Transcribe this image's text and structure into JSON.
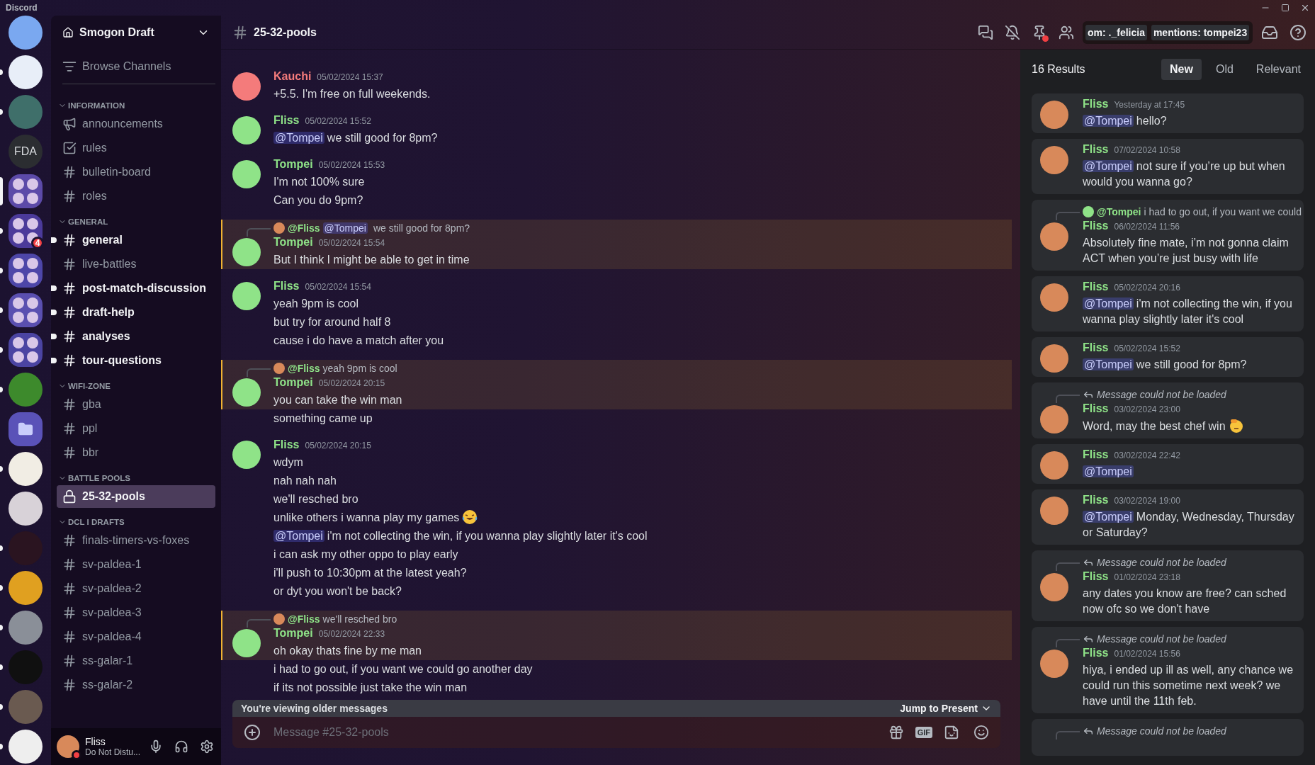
{
  "app": {
    "title": "Discord"
  },
  "servers": [
    {
      "kind": "avatar",
      "color": "#7aa8f0",
      "unread": false,
      "selected": false
    },
    {
      "kind": "avatar",
      "color": "#e8eef8",
      "unread": true,
      "selected": false
    },
    {
      "kind": "avatar",
      "color": "#3f6f6a",
      "unread": true,
      "selected": false
    },
    {
      "kind": "text",
      "label": "FDA",
      "unread": false,
      "selected": false
    },
    {
      "kind": "folder",
      "color": "#5c4aa8",
      "unread": false,
      "selected": true
    },
    {
      "kind": "folder",
      "color": "#4b3a9a",
      "unread": true,
      "selected": false,
      "badge": "4"
    },
    {
      "kind": "folder",
      "color": "#4d46a8",
      "unread": true,
      "selected": false
    },
    {
      "kind": "folder",
      "color": "#5a4fb0",
      "unread": true,
      "selected": false
    },
    {
      "kind": "folder",
      "color": "#4b44a2",
      "unread": true,
      "selected": false
    },
    {
      "kind": "avatar",
      "color": "#3d8a2c",
      "unread": true,
      "selected": false
    },
    {
      "kind": "closed-folder",
      "color": "#5a52b8",
      "unread": false,
      "selected": false
    },
    {
      "kind": "avatar",
      "color": "#f1ede4",
      "unread": true,
      "selected": false
    },
    {
      "kind": "avatar",
      "color": "#d8d2d8",
      "unread": false,
      "selected": false
    },
    {
      "kind": "avatar",
      "color": "#2a1420",
      "unread": true,
      "selected": false
    },
    {
      "kind": "avatar",
      "color": "#e0a020",
      "unread": true,
      "selected": false
    },
    {
      "kind": "avatar",
      "color": "#8a8f98",
      "unread": true,
      "selected": false
    },
    {
      "kind": "avatar",
      "color": "#101010",
      "unread": true,
      "selected": false
    },
    {
      "kind": "avatar",
      "color": "#6a5a50",
      "unread": true,
      "selected": false
    },
    {
      "kind": "avatar",
      "color": "#eeeeee",
      "unread": true,
      "selected": false
    }
  ],
  "server": {
    "name": "Smogon Draft",
    "browse": "Browse Channels"
  },
  "categories": [
    {
      "name": "INFORMATION",
      "expanded": true,
      "channels": [
        {
          "kind": "announcement",
          "name": "announcements",
          "unread": false,
          "selected": false
        },
        {
          "kind": "rules",
          "name": "rules",
          "unread": false,
          "selected": false
        },
        {
          "kind": "text",
          "name": "bulletin-board",
          "unread": false,
          "selected": false
        },
        {
          "kind": "text",
          "name": "roles",
          "unread": false,
          "selected": false
        }
      ]
    },
    {
      "name": "GENERAL",
      "expanded": true,
      "channels": [
        {
          "kind": "text",
          "name": "general",
          "unread": true,
          "selected": false
        },
        {
          "kind": "text",
          "name": "live-battles",
          "unread": false,
          "selected": false
        },
        {
          "kind": "text",
          "name": "post-match-discussion",
          "unread": true,
          "selected": false
        },
        {
          "kind": "text",
          "name": "draft-help",
          "unread": true,
          "selected": false
        },
        {
          "kind": "text",
          "name": "analyses",
          "unread": true,
          "selected": false
        },
        {
          "kind": "text",
          "name": "tour-questions",
          "unread": true,
          "selected": false
        }
      ]
    },
    {
      "name": "WIFI-ZONE",
      "expanded": true,
      "channels": [
        {
          "kind": "text",
          "name": "gba",
          "unread": false,
          "selected": false
        },
        {
          "kind": "text",
          "name": "ppl",
          "unread": false,
          "selected": false
        },
        {
          "kind": "text",
          "name": "bbr",
          "unread": false,
          "selected": false
        }
      ]
    },
    {
      "name": "BATTLE POOLS",
      "expanded": true,
      "channels": [
        {
          "kind": "locked",
          "name": "25-32-pools",
          "unread": false,
          "selected": true
        }
      ]
    },
    {
      "name": "DCL I DRAFTS",
      "expanded": true,
      "channels": [
        {
          "kind": "text",
          "name": "finals-timers-vs-foxes",
          "unread": false,
          "selected": false
        },
        {
          "kind": "text",
          "name": "sv-paldea-1",
          "unread": false,
          "selected": false
        },
        {
          "kind": "text",
          "name": "sv-paldea-2",
          "unread": false,
          "selected": false
        },
        {
          "kind": "text",
          "name": "sv-paldea-3",
          "unread": false,
          "selected": false
        },
        {
          "kind": "text",
          "name": "sv-paldea-4",
          "unread": false,
          "selected": false
        },
        {
          "kind": "text",
          "name": "ss-galar-1",
          "unread": false,
          "selected": false
        },
        {
          "kind": "text",
          "name": "ss-galar-2",
          "unread": false,
          "selected": false
        }
      ]
    }
  ],
  "user": {
    "name": "Fliss",
    "status_text": "Do Not Distu...",
    "do_not_disturb": true
  },
  "header": {
    "channel": "25-32-pools",
    "search_chips": [
      "om: ._felicia",
      "mentions: tompei23"
    ]
  },
  "messages": [
    {
      "author": "Kauchi",
      "color": "#f47b7b",
      "time": "05/02/2024 15:37",
      "lines": [
        {
          "kind": "plain",
          "text": "+5.5. I'm free on full weekends.",
          "highlighted": false
        }
      ]
    },
    {
      "author": "Fliss",
      "color": "#8fe388",
      "time": "05/02/2024 15:52",
      "lines": [
        {
          "kind": "plain",
          "mention": "@Tompei",
          "text": "we still good for 8pm?",
          "highlighted": false
        }
      ]
    },
    {
      "author": "Tompei",
      "color": "#8fe388",
      "time": "05/02/2024 15:53",
      "lines": [
        {
          "kind": "plain",
          "text": "I'm not 100% sure",
          "highlighted": false
        },
        {
          "kind": "plain",
          "text": "Can you do 9pm?",
          "highlighted": false
        }
      ]
    },
    {
      "reply": {
        "author": "@Fliss",
        "mention": "@Tompei",
        "text": "we still good for 8pm?"
      },
      "author": "Tompei",
      "color": "#8fe388",
      "time": "05/02/2024 15:54",
      "lines": [
        {
          "kind": "plain",
          "text": "But I think I might be able to get in time",
          "highlighted": true
        }
      ]
    },
    {
      "author": "Fliss",
      "color": "#8fe388",
      "time": "05/02/2024 15:54",
      "lines": [
        {
          "kind": "plain",
          "text": "yeah 9pm is cool",
          "highlighted": false
        },
        {
          "kind": "plain",
          "text": "but try for around half 8",
          "highlighted": false
        },
        {
          "kind": "plain",
          "text": "cause i do have a match after you",
          "highlighted": false
        }
      ]
    },
    {
      "reply": {
        "author": "@Fliss",
        "text": "yeah 9pm is cool"
      },
      "author": "Tompei",
      "color": "#8fe388",
      "time": "05/02/2024 20:15",
      "lines": [
        {
          "kind": "plain",
          "text": "you can take the win man",
          "highlighted": true
        },
        {
          "kind": "plain",
          "text": "something came up",
          "highlighted": false
        }
      ]
    },
    {
      "author": "Fliss",
      "color": "#8fe388",
      "time": "05/02/2024 20:15",
      "lines": [
        {
          "kind": "plain",
          "text": "wdym",
          "highlighted": false
        },
        {
          "kind": "plain",
          "text": "nah nah nah",
          "highlighted": false
        },
        {
          "kind": "plain",
          "text": "we'll resched bro",
          "highlighted": false
        },
        {
          "kind": "laughing-emoji",
          "text": "unlike others i wanna play my games",
          "highlighted": false
        },
        {
          "kind": "plain",
          "mention": "@Tompei",
          "text": "i'm not collecting the win, if you wanna play slightly later it's cool",
          "highlighted": false
        },
        {
          "kind": "plain",
          "text": "i can ask my other oppo to play early",
          "highlighted": false
        },
        {
          "kind": "plain",
          "text": "i'll push to 10:30pm at the latest yeah?",
          "highlighted": false
        },
        {
          "kind": "plain",
          "text": "or dyt you won't be back?",
          "highlighted": false
        }
      ]
    },
    {
      "reply": {
        "author": "@Fliss",
        "text": "we'll resched bro"
      },
      "author": "Tompei",
      "color": "#8fe388",
      "time": "05/02/2024 22:33",
      "lines": [
        {
          "kind": "plain",
          "text": "oh okay thats fine by me man",
          "highlighted": true
        },
        {
          "kind": "plain",
          "text": "i had to go out, if you want we could go another day",
          "highlighted": false
        },
        {
          "kind": "plain",
          "text": "if its not possible just take the win man",
          "highlighted": false
        }
      ]
    }
  ],
  "older_bar": {
    "text": "You're viewing older messages",
    "action": "Jump to Present"
  },
  "composer": {
    "placeholder": "Message #25-32-pools",
    "gif": "GIF"
  },
  "search": {
    "count": "16 Results",
    "sorts": [
      {
        "label": "New",
        "selected": true
      },
      {
        "label": "Old",
        "selected": false
      },
      {
        "label": "Relevant",
        "selected": false
      }
    ],
    "results": [
      {
        "kind": "plain",
        "author": "Fliss",
        "color": "#8fe388",
        "time": "Yesterday at 17:45",
        "mention": "@Tompei",
        "text": "hello?"
      },
      {
        "kind": "plain",
        "author": "Fliss",
        "color": "#8fe388",
        "time": "07/02/2024 10:58",
        "mention": "@Tompei",
        "text": "not sure if you’re up but when would you wanna go?"
      },
      {
        "kind": "plain",
        "reply": {
          "kind": "user",
          "author": "@Tompei",
          "text": "i had to go out, if you want we could"
        },
        "author": "Fliss",
        "color": "#8fe388",
        "time": "06/02/2024 11:56",
        "text": "Absolutely fine mate, i’m not gonna claim ACT when you’re just busy with life"
      },
      {
        "kind": "plain",
        "author": "Fliss",
        "color": "#8fe388",
        "time": "05/02/2024 20:16",
        "mention": "@Tompei",
        "text": "i'm not collecting the win, if you wanna play slightly later it's cool"
      },
      {
        "kind": "plain",
        "author": "Fliss",
        "color": "#8fe388",
        "time": "05/02/2024 15:52",
        "mention": "@Tompei",
        "text": "we still good for 8pm?"
      },
      {
        "kind": "saluting-emoji",
        "reply": {
          "kind": "unloaded",
          "text": "Message could not be loaded"
        },
        "author": "Fliss",
        "color": "#8fe388",
        "time": "03/02/2024 23:00",
        "text": "Word, may the best chef win"
      },
      {
        "kind": "plain",
        "author": "Fliss",
        "color": "#8fe388",
        "time": "03/02/2024 22:42",
        "mention": "@Tompei"
      },
      {
        "kind": "plain",
        "author": "Fliss",
        "color": "#8fe388",
        "time": "03/02/2024 19:00",
        "mention": "@Tompei",
        "text": "Monday, Wednesday, Thursday or Saturday?"
      },
      {
        "kind": "plain",
        "reply": {
          "kind": "unloaded",
          "text": "Message could not be loaded"
        },
        "author": "Fliss",
        "color": "#8fe388",
        "time": "01/02/2024 23:18",
        "text": "any dates you know are free? can sched now ofc so we don't have"
      },
      {
        "kind": "plain",
        "reply": {
          "kind": "unloaded",
          "text": "Message could not be loaded"
        },
        "author": "Fliss",
        "color": "#8fe388",
        "time": "01/02/2024 15:56",
        "text": "hiya, i ended up ill as well, any chance we could run this sometime next week? we have until the 11th feb."
      },
      {
        "reply": {
          "kind": "unloaded",
          "text": "Message could not be loaded"
        }
      }
    ]
  }
}
